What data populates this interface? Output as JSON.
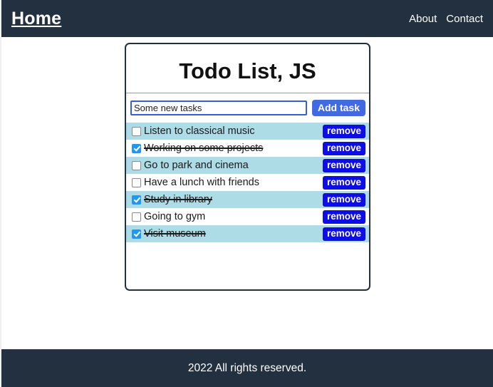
{
  "header": {
    "brand": "Home",
    "links": [
      {
        "label": "About"
      },
      {
        "label": "Contact"
      }
    ]
  },
  "card": {
    "title": "Todo List, JS",
    "input": {
      "value": "",
      "placeholder": "Some new tasks"
    },
    "add_label": "Add task",
    "remove_label": "remove",
    "tasks": [
      {
        "label": "Listen to classical music",
        "done": false
      },
      {
        "label": "Working on some projects",
        "done": true
      },
      {
        "label": "Go to park and cinema",
        "done": false
      },
      {
        "label": "Have a lunch with friends",
        "done": false
      },
      {
        "label": "Study in library",
        "done": true
      },
      {
        "label": "Going to gym",
        "done": false
      },
      {
        "label": "Visit museum",
        "done": true
      }
    ]
  },
  "footer": {
    "text": "2022 All rights reserved."
  },
  "colors": {
    "navy": "#22303f",
    "row_alt": "#addbe6",
    "add_button": "#4169e1",
    "remove_button": "#0d0de8",
    "checkbox_checked": "#2196f3",
    "input_border": "#3b5bdb"
  }
}
